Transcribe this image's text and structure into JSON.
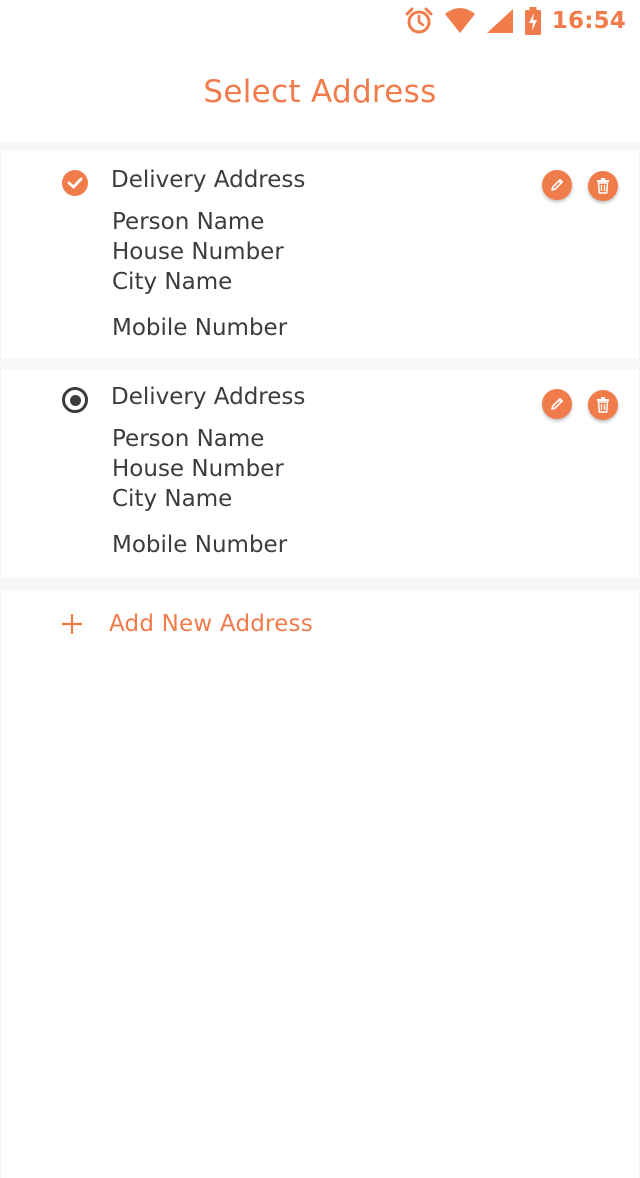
{
  "status_bar": {
    "time": "16:54",
    "icons": [
      "alarm-icon",
      "wifi-icon",
      "signal-icon",
      "battery-charging-icon"
    ],
    "color": "#f07c4b"
  },
  "header": {
    "title": "Select Address"
  },
  "addresses": [
    {
      "selected": true,
      "title": "Delivery Address",
      "person_name": "Person Name",
      "house_number": "House Number",
      "city_name": "City Name",
      "mobile_number": "Mobile Number"
    },
    {
      "selected": false,
      "title": "Delivery Address",
      "person_name": "Person Name",
      "house_number": "House Number",
      "city_name": "City Name",
      "mobile_number": "Mobile Number"
    }
  ],
  "add_new": {
    "label": "Add New Address",
    "icon": "plus-icon"
  },
  "colors": {
    "accent": "#f07c4b",
    "text": "#3c3c3c",
    "band": "#f7f7f7"
  }
}
